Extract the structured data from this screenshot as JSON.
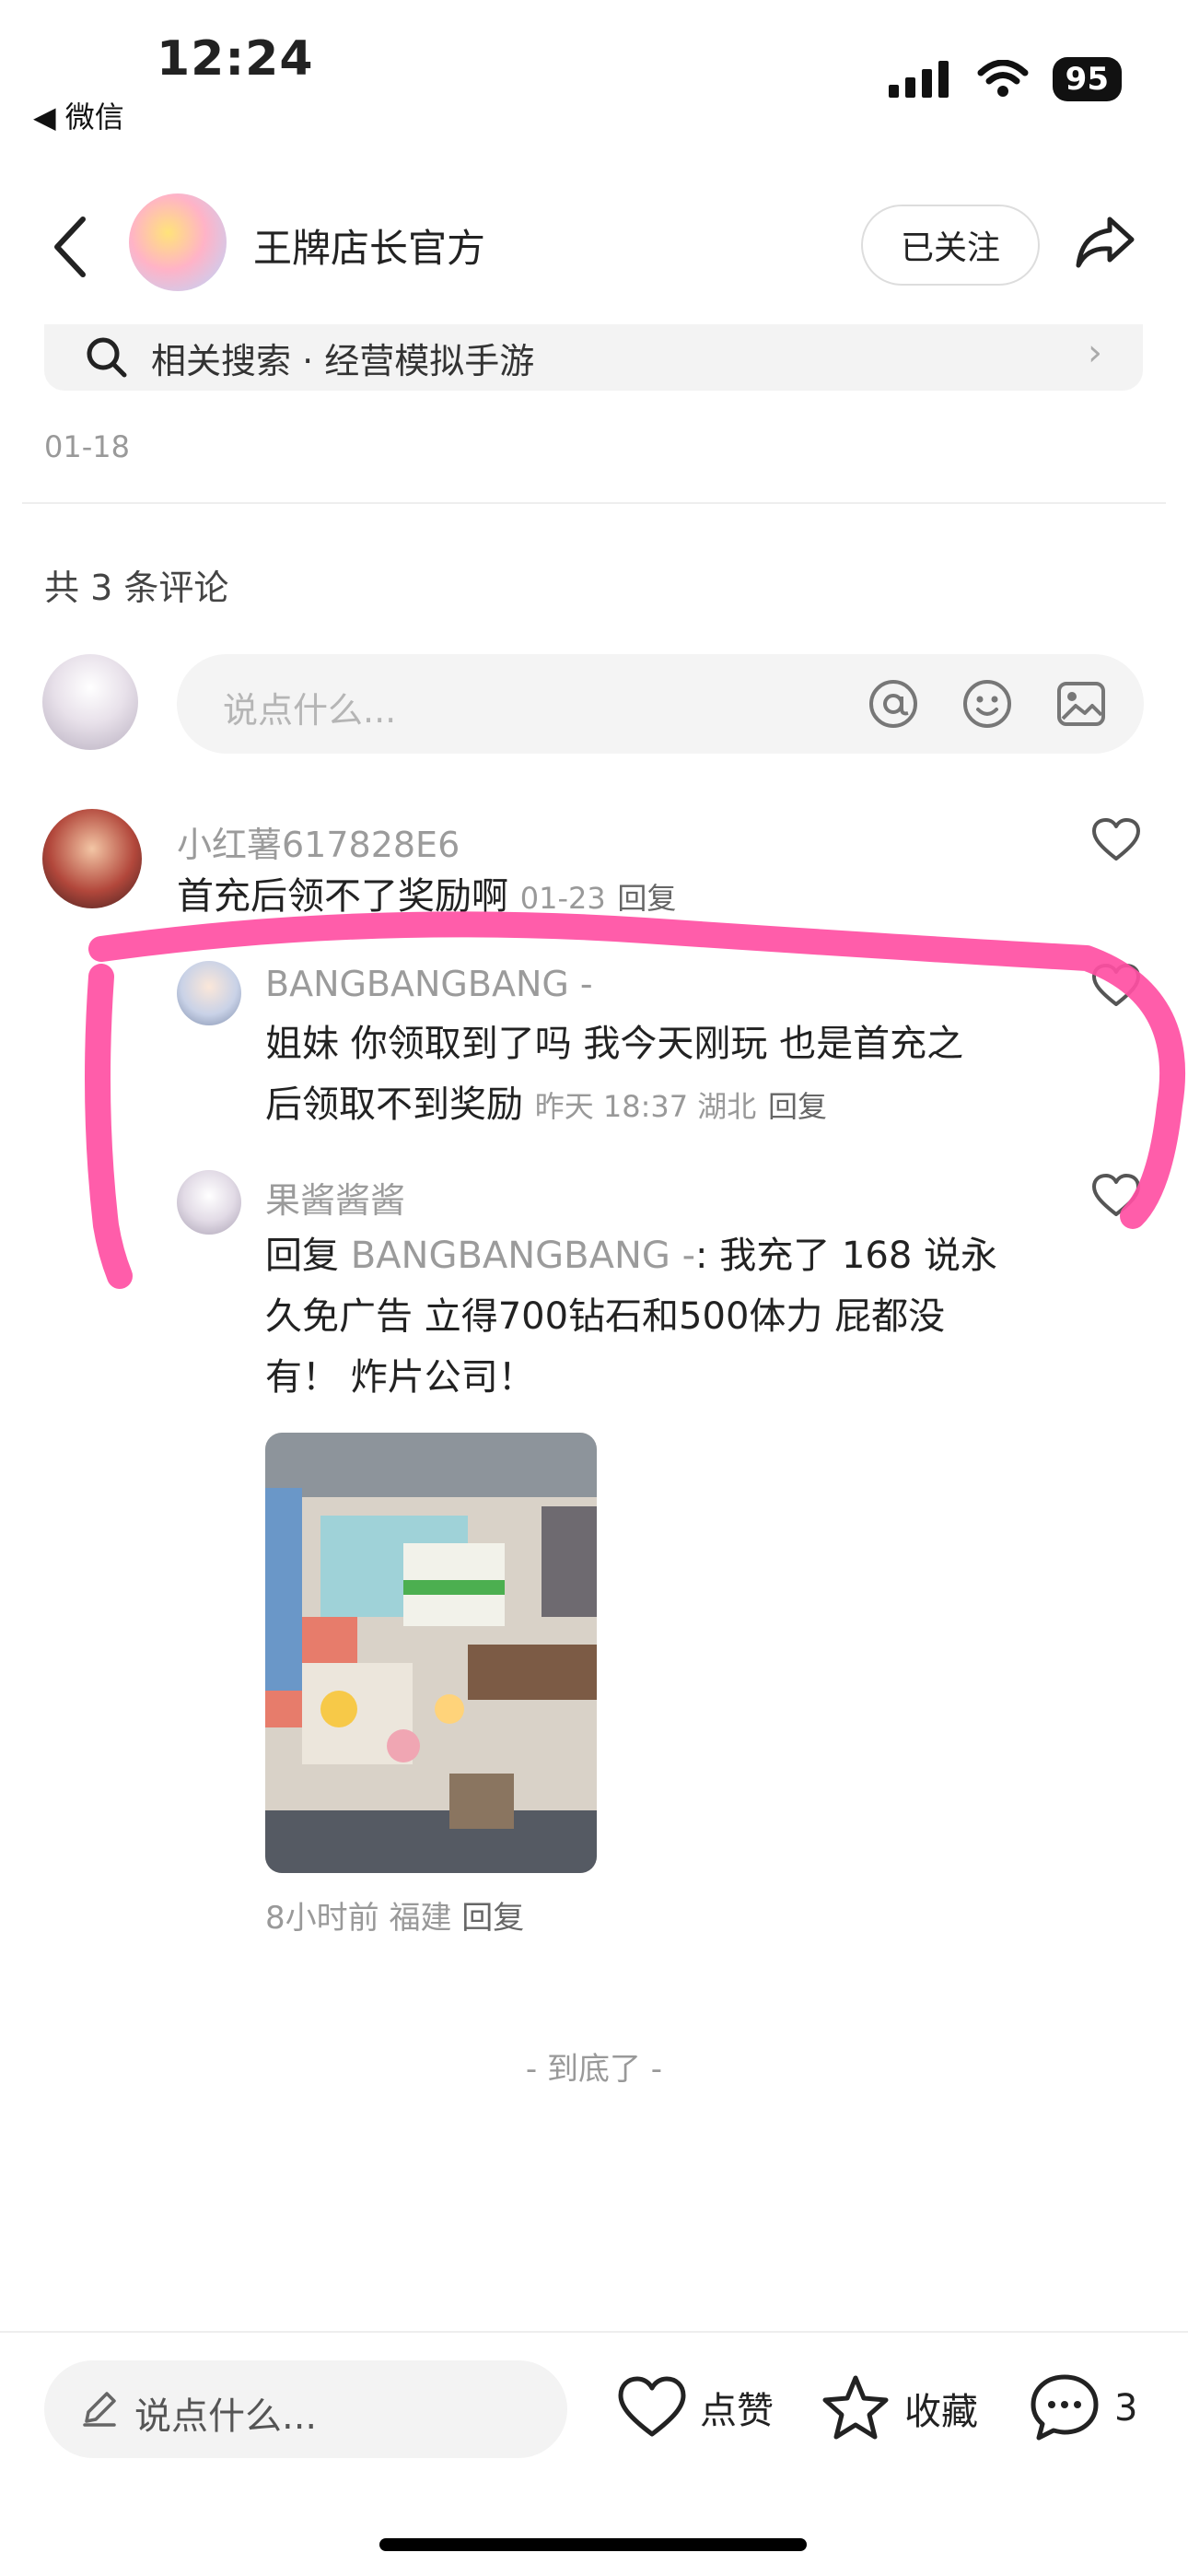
{
  "status_bar": {
    "time": "12:24",
    "back_app": "◀ 微信",
    "battery": "95"
  },
  "header": {
    "title": "王牌店长官方",
    "follow_label": "已关注"
  },
  "related_search": {
    "label": "相关搜索 · 经营模拟手游"
  },
  "post": {
    "date": "01-18"
  },
  "comments_section": {
    "count_label": "共 3 条评论",
    "input_placeholder": "说点什么..."
  },
  "comments": [
    {
      "user": "小红薯617828E6",
      "text": "首充后领不了奖励啊",
      "date": "01-23",
      "reply_label": "回复"
    },
    {
      "user": "BANGBANGBANG -",
      "text_line1": "姐妹 你领取到了吗 我今天刚玩 也是首充之",
      "text_line2": "后领取不到奖励",
      "meta": "昨天 18:37 湖北",
      "reply_label": "回复"
    },
    {
      "user": "果酱酱酱",
      "reply_prefix": "回复 ",
      "reply_target": "BANGBANGBANG -",
      "text_line1_rest": ": 我充了 168 说永",
      "text_line2": "久免广告 立得700钻石和500体力 屁都没",
      "text_line3": "有！ 炸片公司！",
      "meta": "8小时前 福建",
      "reply_label": "回复"
    }
  ],
  "end_label": "- 到底了 -",
  "bottom_bar": {
    "input_placeholder": "说点什么...",
    "like_label": "点赞",
    "collect_label": "收藏",
    "comment_count": "3"
  },
  "colors": {
    "marker": "#ff4fa3",
    "grey_text": "#999999"
  }
}
